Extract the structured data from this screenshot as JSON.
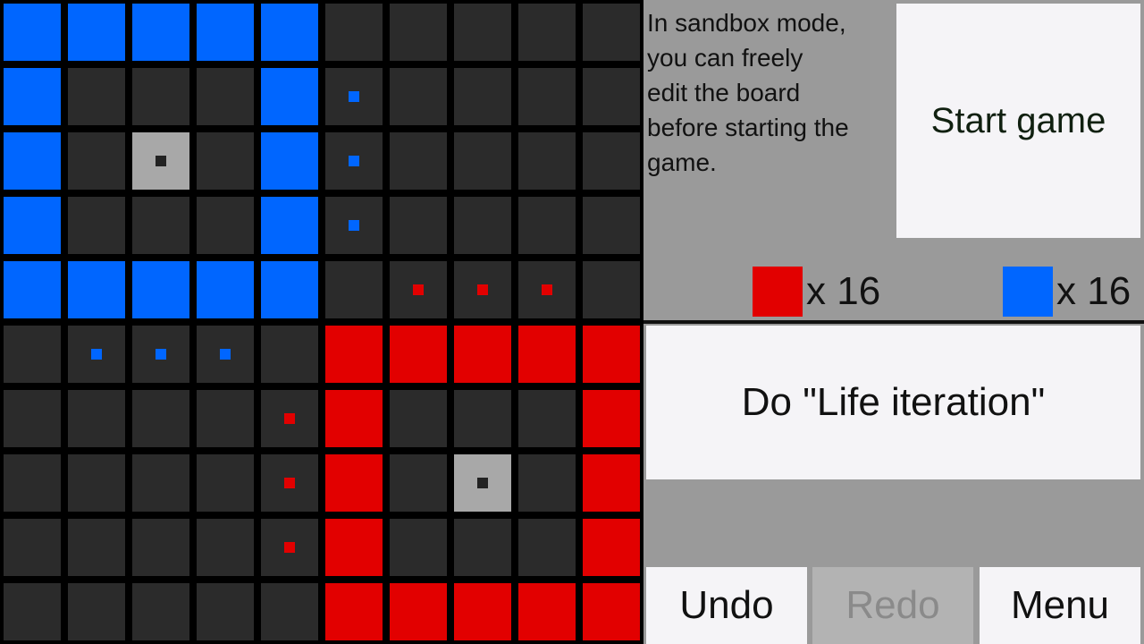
{
  "board": {
    "rows": 10,
    "cols": 10,
    "colors": {
      "empty": "#2b2b2b",
      "red": "#e20000",
      "blue": "#0066ff",
      "selected": "#a8a8a8",
      "selected_dot": "#222222"
    },
    "cells": [
      "BBBBB.....",
      "B...Bb....",
      "B.S.Bb....",
      "B...Bb....",
      "BBBBB.rrr.",
      ".bbb.RRRRR",
      "....rR...R",
      "....rR.S.R",
      "....rR...R",
      ".....RRRRR"
    ]
  },
  "panel": {
    "info_text": "In sandbox mode,\nyou can freely\nedit the board\nbefore starting the\ngame.",
    "start_label": "Start game",
    "red_count": "x 16",
    "blue_count": "x 16",
    "red_color": "#e20000",
    "blue_color": "#0066ff",
    "life_label": "Do \"Life iteration\"",
    "undo_label": "Undo",
    "redo_label": "Redo",
    "menu_label": "Menu"
  }
}
